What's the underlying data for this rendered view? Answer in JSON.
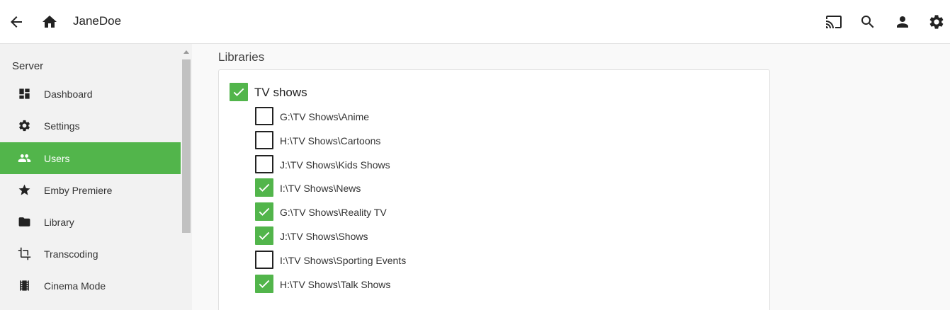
{
  "header": {
    "title": "JaneDoe",
    "icons": [
      "back-arrow-icon",
      "home-icon",
      "cast-icon",
      "search-icon",
      "person-icon",
      "gear-icon"
    ]
  },
  "sidebar": {
    "heading": "Server",
    "items": [
      {
        "label": "Dashboard",
        "icon": "dashboard-icon",
        "active": false
      },
      {
        "label": "Settings",
        "icon": "gear-icon",
        "active": false
      },
      {
        "label": "Users",
        "icon": "people-icon",
        "active": true
      },
      {
        "label": "Emby Premiere",
        "icon": "star-icon",
        "active": false
      },
      {
        "label": "Library",
        "icon": "folder-icon",
        "active": false
      },
      {
        "label": "Transcoding",
        "icon": "crop-icon",
        "active": false
      },
      {
        "label": "Cinema Mode",
        "icon": "film-icon",
        "active": false
      }
    ]
  },
  "libraries": {
    "section_title": "Libraries",
    "parent": {
      "label": "TV shows",
      "checked": true
    },
    "folders": [
      {
        "label": "G:\\TV Shows\\Anime",
        "checked": false
      },
      {
        "label": "H:\\TV Shows\\Cartoons",
        "checked": false
      },
      {
        "label": "J:\\TV Shows\\Kids Shows",
        "checked": false
      },
      {
        "label": "I:\\TV Shows\\News",
        "checked": true
      },
      {
        "label": "G:\\TV Shows\\Reality TV",
        "checked": true
      },
      {
        "label": "J:\\TV Shows\\Shows",
        "checked": true
      },
      {
        "label": "I:\\TV Shows\\Sporting Events",
        "checked": false
      },
      {
        "label": "H:\\TV Shows\\Talk Shows",
        "checked": true
      }
    ]
  },
  "colors": {
    "accent": "#52b54b",
    "sidebar_bg": "#f2f2f2",
    "page_bg": "#f9f9f9"
  }
}
